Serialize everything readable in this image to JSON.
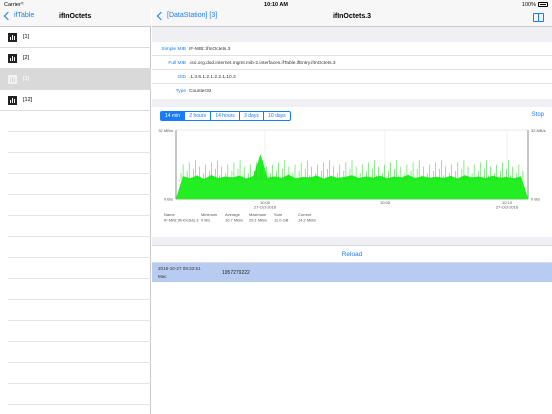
{
  "status_bar": {
    "carrier": "Carrier",
    "time": "10:10 AM",
    "battery": "100%"
  },
  "left": {
    "back_label": "ifTable",
    "title": "ifInOctets",
    "items": [
      {
        "label": "[1]"
      },
      {
        "label": "[2]"
      },
      {
        "label": "[3]"
      },
      {
        "label": "[12]"
      }
    ],
    "selected_index": 2
  },
  "right": {
    "back_label": "[DataStation] [3]",
    "title": "ifInOctets.3",
    "info": [
      {
        "key": "Simple MIB",
        "value": "IF-MIB::ifInOctets.3"
      },
      {
        "key": "Full MIB",
        "value": ".iso.org.dod.internet.mgmt.mib-2.interfaces.ifTable.ifEntry.ifInOctets.3"
      },
      {
        "key": "OID",
        "value": ".1.3.6.1.2.1.2.2.1.10.3"
      },
      {
        "key": "Type",
        "value": "Counter32"
      }
    ],
    "ranges": [
      "14 min",
      "2 hours",
      "14 hours",
      "3 days",
      "10 days"
    ],
    "active_range": 0,
    "stop_label": "Stop",
    "reload_label": "Reload",
    "latest": {
      "timestamp": "2016-10-27 09:32:51",
      "format": "Mac",
      "value": "1957279222"
    }
  },
  "chart_data": {
    "type": "area",
    "color": "#22ee22",
    "ylim": [
      0,
      32
    ],
    "ytick_labels": [
      "32 MB/s",
      "0 B/s"
    ],
    "xtick_labels": [
      {
        "time": "10:00",
        "date": "27-Oct-2016"
      },
      {
        "time": "10:05",
        "date": ""
      },
      {
        "time": "10:10",
        "date": "27-Oct-2016"
      }
    ],
    "series": [
      {
        "values": [
          0,
          10.5,
          9.5,
          10.8,
          9.2,
          11.0,
          9.6,
          10.3,
          9.9,
          10.7,
          9.4,
          10.6,
          20.5,
          9.8,
          10.4,
          9.7,
          11.2,
          9.5,
          10.1,
          9.9,
          10.8,
          9.3,
          10.6,
          9.7,
          10.2,
          10.9,
          9.6,
          10.4,
          9.8,
          10.7,
          9.5,
          10.3,
          9.9,
          11.1,
          9.6,
          10.5,
          9.8,
          10.2,
          9.7,
          10.6,
          9.4,
          10.9,
          9.9,
          10.3,
          9.6,
          10.7,
          9.8,
          10.1,
          9.5,
          10.4,
          0
        ]
      }
    ],
    "legend": {
      "headers": [
        "Name",
        "Minimum",
        "Average",
        "Maximum",
        "Sum",
        "Current"
      ],
      "row": [
        "IF-MIB::ifInOctets.3",
        "0 B/s",
        "10.7 MB/s",
        "29.1 MB/s",
        "11.0 GB",
        "14.2 MB/s"
      ]
    }
  }
}
